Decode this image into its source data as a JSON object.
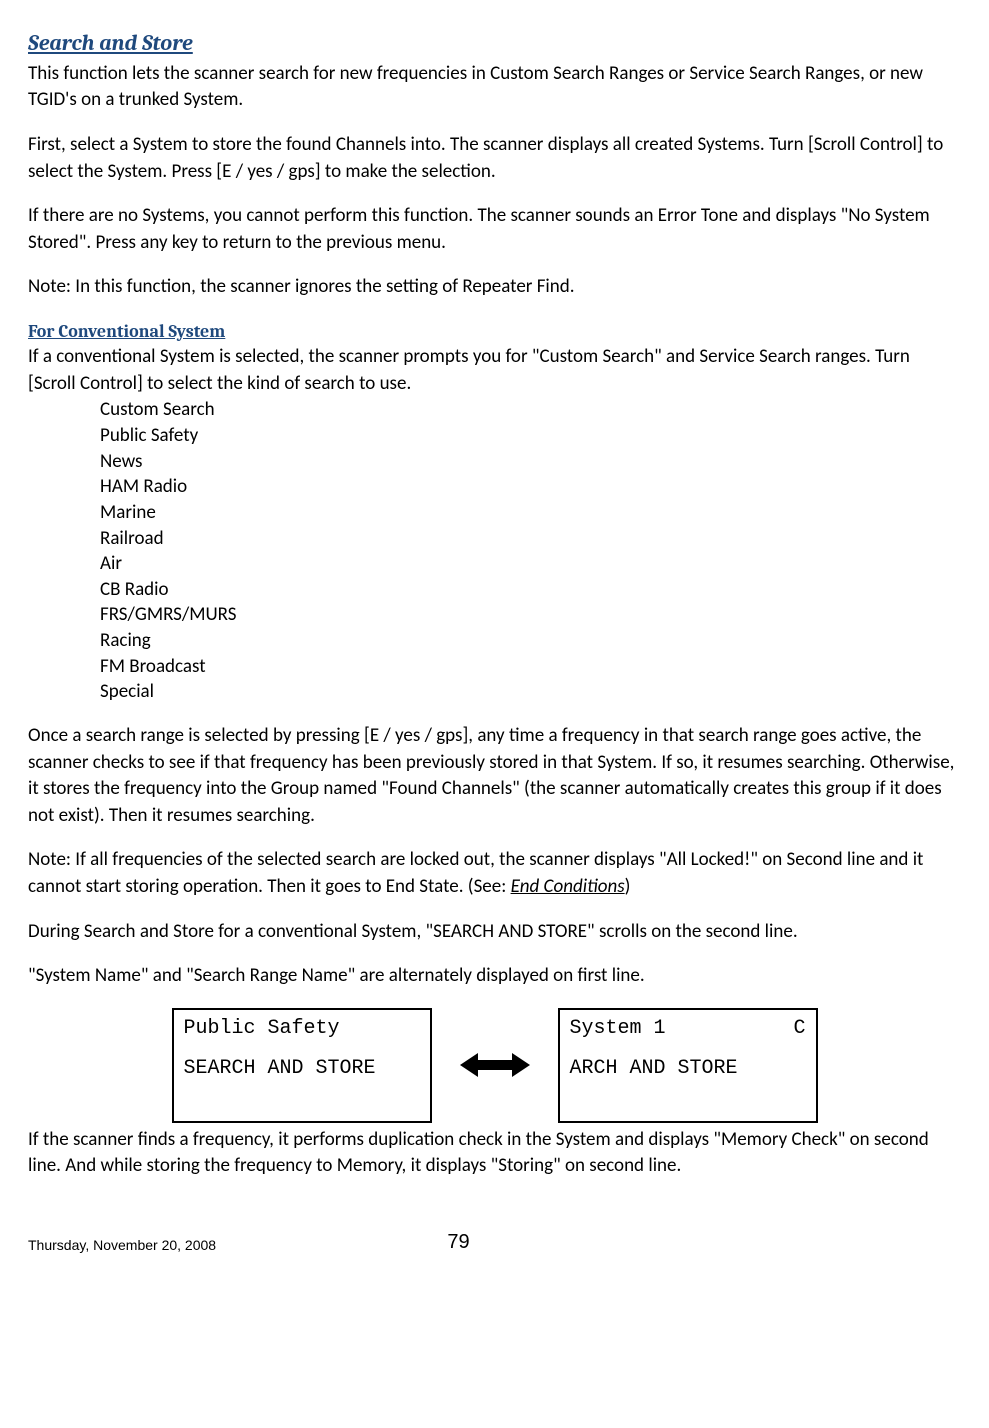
{
  "heading1": "Search and Store",
  "para1": "This function lets the scanner search for new frequencies in Custom Search Ranges or Service Search Ranges, or new TGID's on a trunked System.",
  "para2": "First, select a System to store the found Channels into. The scanner displays all created Systems. Turn [Scroll Control] to select the System. Press [E / yes / gps] to make the selection.",
  "para3": "If there are no Systems, you cannot perform this function. The scanner sounds an Error Tone and displays \"No System Stored\". Press any key to return to the previous menu.",
  "para4": "Note:  In this function, the scanner ignores the setting of Repeater Find.",
  "heading2": "For Conventional System",
  "para5": "If a conventional System is selected, the scanner prompts you for \"Custom Search\" and Service Search ranges. Turn [Scroll Control] to select the kind of search to use.",
  "search_list": [
    "Custom Search",
    "Public Safety",
    "News",
    "HAM Radio",
    "Marine",
    "Railroad",
    "Air",
    "CB Radio",
    "FRS/GMRS/MURS",
    "Racing",
    "FM Broadcast",
    "Special"
  ],
  "para6": "Once a search range is selected by pressing [E / yes / gps], any time a frequency in that search range goes active, the scanner checks to see if that frequency has been previously stored in that System. If so, it resumes searching. Otherwise, it stores the frequency into the Group named \"Found Channels\" (the scanner automatically creates this group if it does not exist). Then it resumes searching.",
  "para7a": "Note: If all frequencies of the selected search are locked out, the scanner displays \"All Locked!\" on Second line and it cannot start storing operation. Then it goes to End State. (See: ",
  "para7_link": "End Conditions",
  "para7b": ")",
  "para8": "During Search and Store for a conventional System, \"SEARCH AND STORE\" scrolls on the second line.",
  "para9": "\"System Name\" and \"Search Range Name\" are alternately displayed on first line.",
  "display1": {
    "line1_left": "Public Safety",
    "line1_right": "",
    "line2": "SEARCH AND STORE"
  },
  "display2": {
    "line1_left": "System 1",
    "line1_right": "C",
    "line2": "ARCH AND STORE"
  },
  "para10": "If the scanner finds a frequency, it performs duplication check in the System and displays \"Memory Check\" on second line. And while storing the frequency to Memory, it displays \"Storing\" on second line.",
  "footer_date": "Thursday, November 20, 2008",
  "footer_page": "79"
}
